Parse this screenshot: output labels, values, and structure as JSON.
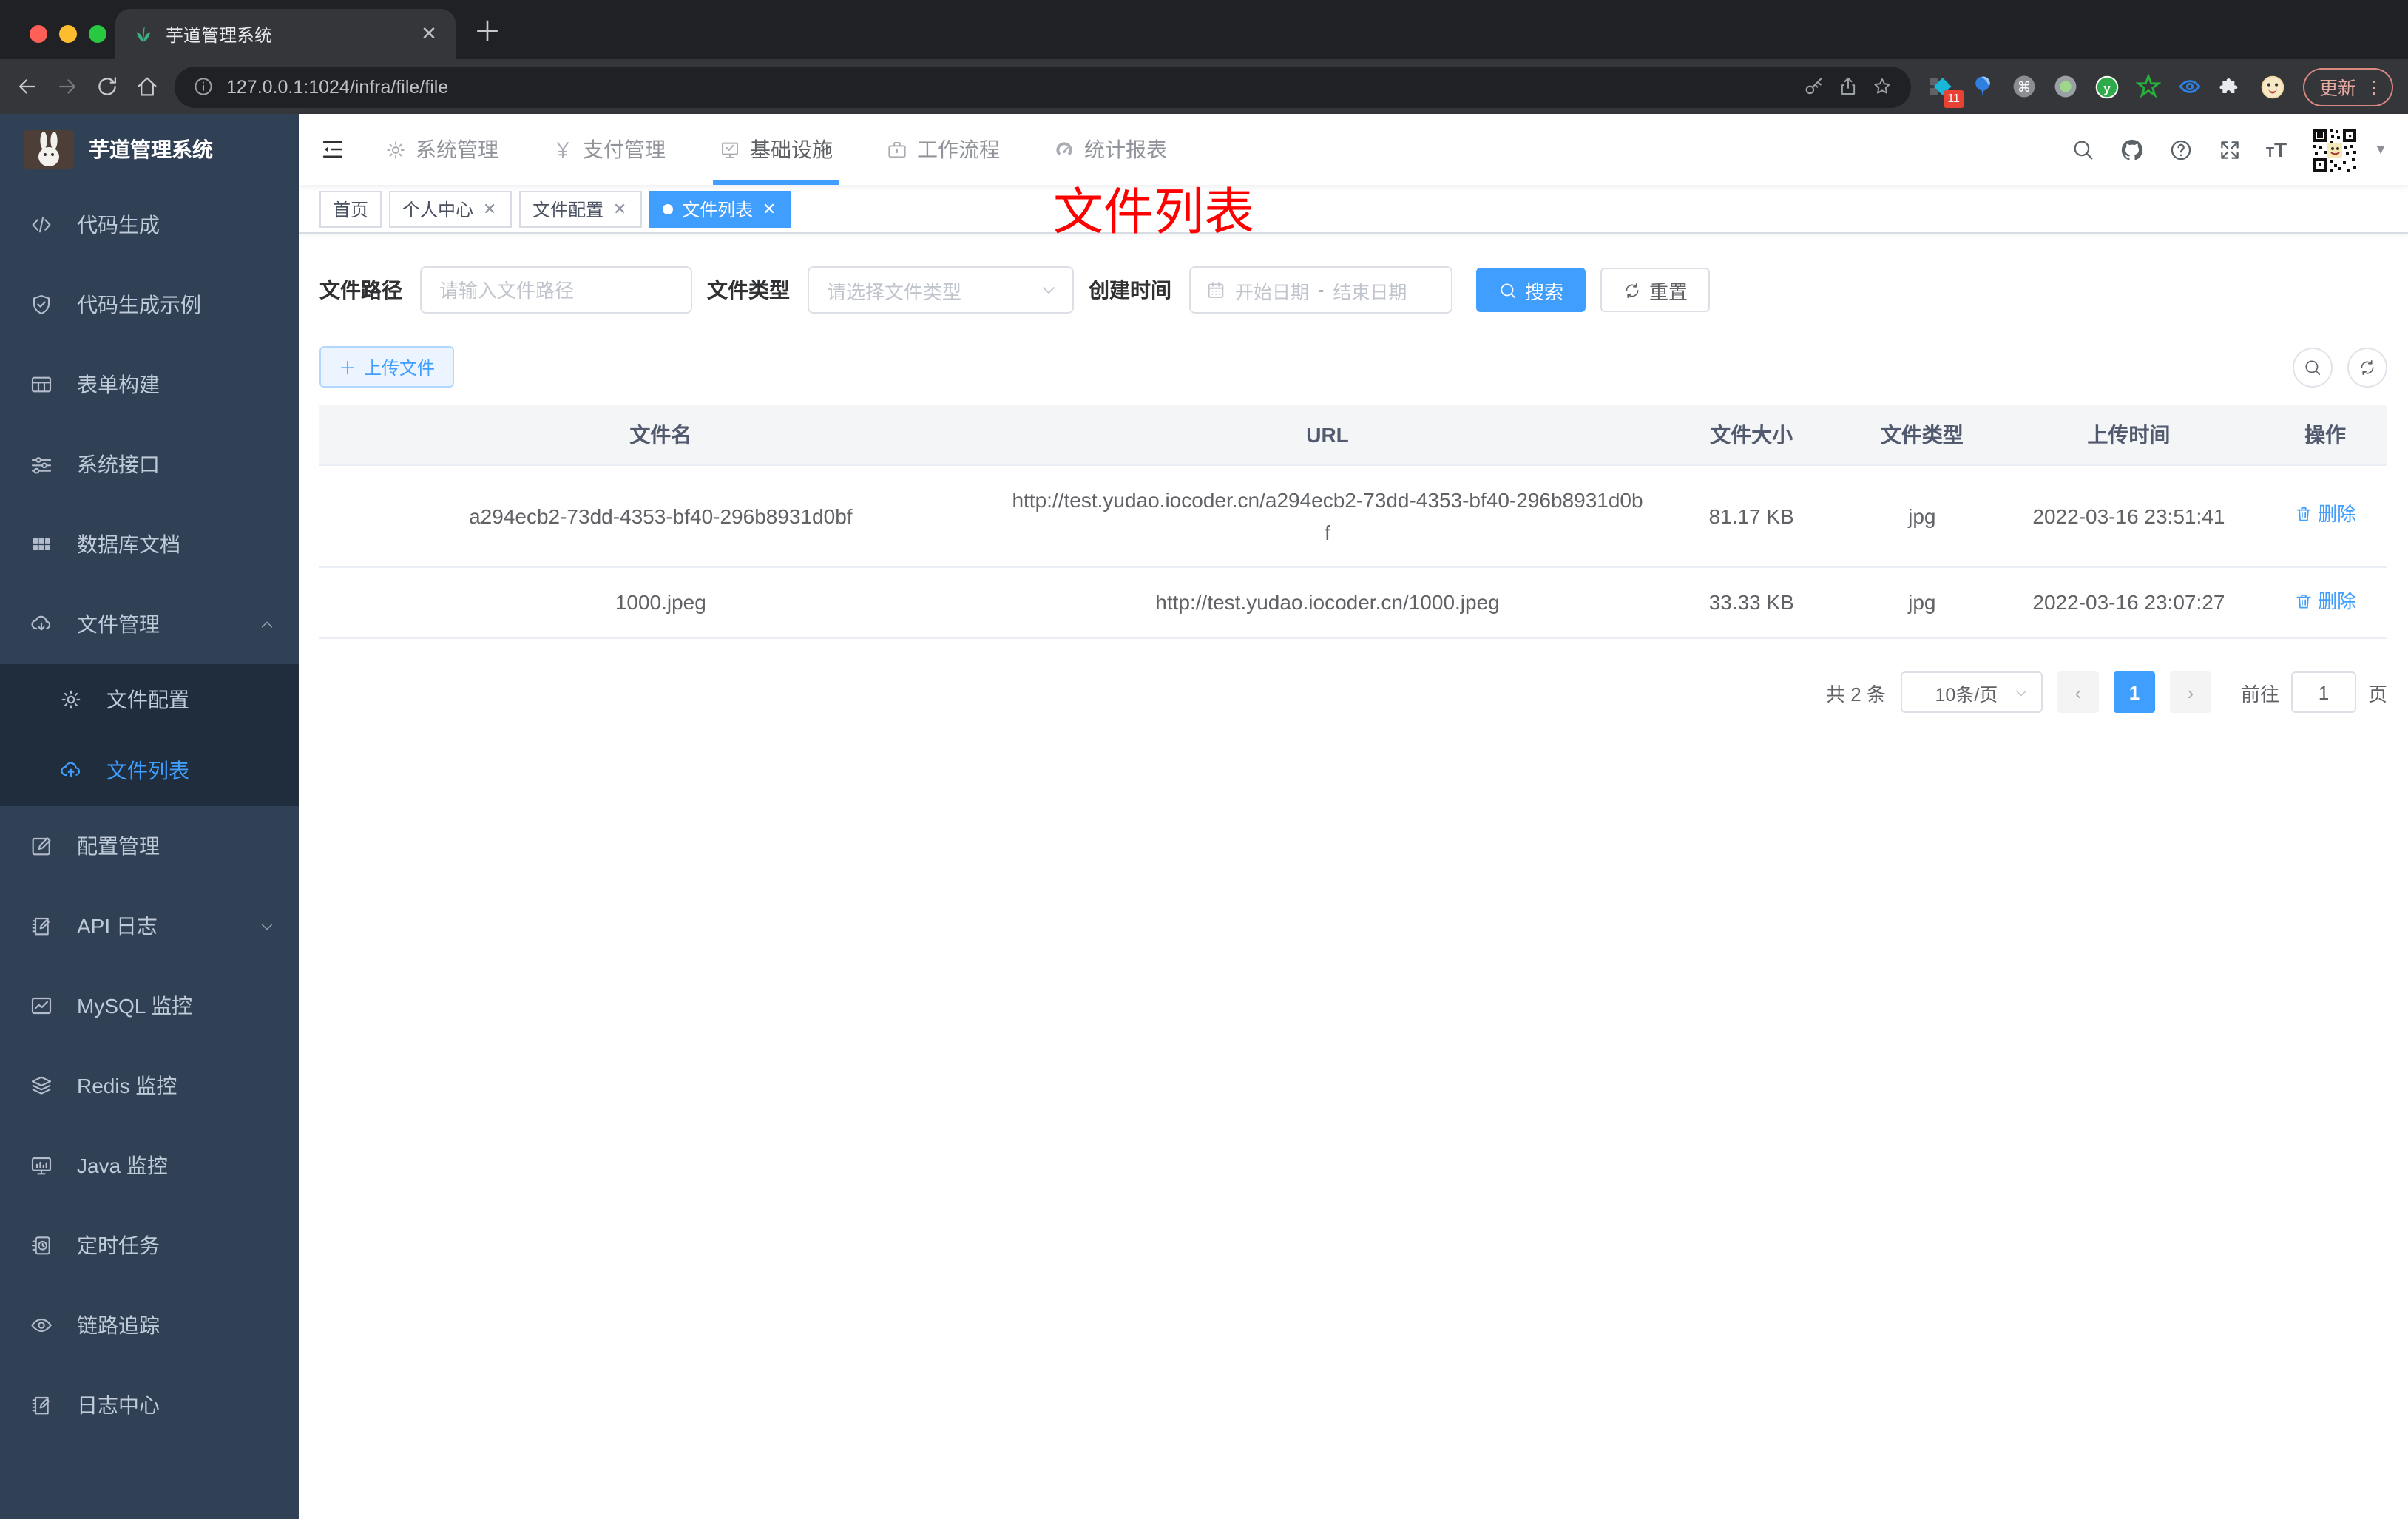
{
  "browser": {
    "tab_title": "芋道管理系统",
    "url": "127.0.0.1:1024/infra/file/file",
    "extension_badge": "11",
    "update_label": "更新"
  },
  "header": {
    "menu": [
      {
        "label": "系统管理",
        "icon": "gear",
        "active": false
      },
      {
        "label": "支付管理",
        "icon": "yen",
        "active": false
      },
      {
        "label": "基础设施",
        "icon": "moncheck",
        "active": true
      },
      {
        "label": "工作流程",
        "icon": "briefcase",
        "active": false
      },
      {
        "label": "统计报表",
        "icon": "dashboard",
        "active": false
      }
    ]
  },
  "sidebar": {
    "title": "芋道管理系统",
    "items": [
      {
        "label": "代码生成",
        "icon": "code"
      },
      {
        "label": "代码生成示例",
        "icon": "shield"
      },
      {
        "label": "表单构建",
        "icon": "form"
      },
      {
        "label": "系统接口",
        "icon": "sliders"
      },
      {
        "label": "数据库文档",
        "icon": "grid"
      },
      {
        "label": "文件管理",
        "icon": "cloudDown",
        "arrow": "up",
        "children": [
          {
            "label": "文件配置",
            "icon": "gear2"
          },
          {
            "label": "文件列表",
            "icon": "cloudUp",
            "active": true
          }
        ]
      },
      {
        "label": "配置管理",
        "icon": "edit"
      },
      {
        "label": "API 日志",
        "icon": "doc",
        "arrow": "down"
      },
      {
        "label": "MySQL 监控",
        "icon": "chart"
      },
      {
        "label": "Redis 监控",
        "icon": "layers"
      },
      {
        "label": "Java 监控",
        "icon": "monitor"
      },
      {
        "label": "定时任务",
        "icon": "timer"
      },
      {
        "label": "链路追踪",
        "icon": "eye"
      },
      {
        "label": "日志中心",
        "icon": "doc"
      }
    ]
  },
  "tags": [
    {
      "label": "首页",
      "closable": false,
      "active": false
    },
    {
      "label": "个人中心",
      "closable": true,
      "active": false
    },
    {
      "label": "文件配置",
      "closable": true,
      "active": false
    },
    {
      "label": "文件列表",
      "closable": true,
      "active": true
    }
  ],
  "annotation": "文件列表",
  "filters": {
    "path_label": "文件路径",
    "path_placeholder": "请输入文件路径",
    "type_label": "文件类型",
    "type_placeholder": "请选择文件类型",
    "date_label": "创建时间",
    "date_start": "开始日期",
    "date_separator": "-",
    "date_end": "结束日期",
    "search_label": "搜索",
    "reset_label": "重置"
  },
  "toolbar": {
    "upload_label": "上传文件"
  },
  "table": {
    "headers": [
      "文件名",
      "URL",
      "文件大小",
      "文件类型",
      "上传时间",
      "操作"
    ],
    "rows": [
      {
        "name": "a294ecb2-73dd-4353-bf40-296b8931d0bf",
        "url": "http://test.yudao.iocoder.cn/a294ecb2-73dd-4353-bf40-296b8931d0bf",
        "size": "81.17 KB",
        "type": "jpg",
        "time": "2022-03-16 23:51:41",
        "action": "删除"
      },
      {
        "name": "1000.jpeg",
        "url": "http://test.yudao.iocoder.cn/1000.jpeg",
        "size": "33.33 KB",
        "type": "jpg",
        "time": "2022-03-16 23:07:27",
        "action": "删除"
      }
    ]
  },
  "pagination": {
    "total": "共 2 条",
    "page_size": "10条/页",
    "current_page": "1",
    "goto_label": "前往",
    "goto_value": "1",
    "page_suffix": "页"
  },
  "colors": {
    "accent": "#409eff",
    "sidebar_bg": "#304156",
    "submenu_bg": "#1f2d3d",
    "annotation_red": "#ff0000"
  }
}
